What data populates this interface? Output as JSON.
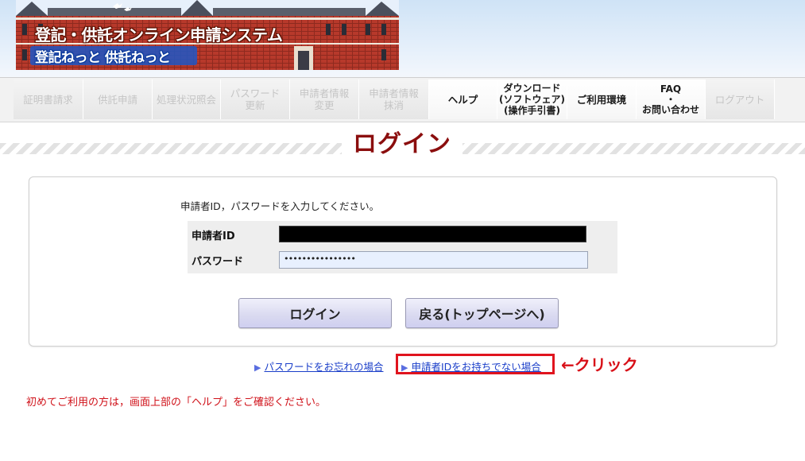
{
  "header": {
    "title": "登記・供託オンライン申請システム",
    "subtitle": "登記ねっと 供託ねっと"
  },
  "nav": [
    {
      "label": "証明書請求",
      "state": "disabled"
    },
    {
      "label": "供託申請",
      "state": "disabled"
    },
    {
      "label": "処理状況照会",
      "state": "disabled"
    },
    {
      "label": "パスワード\n更新",
      "state": "disabled"
    },
    {
      "label": "申請者情報\n変更",
      "state": "disabled"
    },
    {
      "label": "申請者情報\n抹消",
      "state": "disabled"
    },
    {
      "label": "ヘルプ",
      "state": "active"
    },
    {
      "label": "ダウンロード\n(ソフトウェア)\n(操作手引書)",
      "state": "active"
    },
    {
      "label": "ご利用環境",
      "state": "active"
    },
    {
      "label": "FAQ\n・\nお問い合わせ",
      "state": "active"
    },
    {
      "label": "ログアウト",
      "state": "disabled"
    }
  ],
  "page_title": "ログイン",
  "login": {
    "instruction": "申請者ID，パスワードを入力してください。",
    "id_label": "申請者ID",
    "id_value": "",
    "password_label": "パスワード",
    "password_value": "••••••••••••••••",
    "login_button": "ログイン",
    "back_button": "戻る(トップページへ)"
  },
  "links": {
    "forgot_password": "パスワードをお忘れの場合",
    "no_applicant_id": "申請者IDをお持ちでない場合"
  },
  "annotation": {
    "callout": "←クリック",
    "color": "#e0141e"
  },
  "notice": "初めてご利用の方は，画面上部の「ヘルプ」をご確認ください。",
  "colors": {
    "title": "#8b0e0e",
    "link": "#1a3ec9",
    "notice": "#d0121a"
  }
}
